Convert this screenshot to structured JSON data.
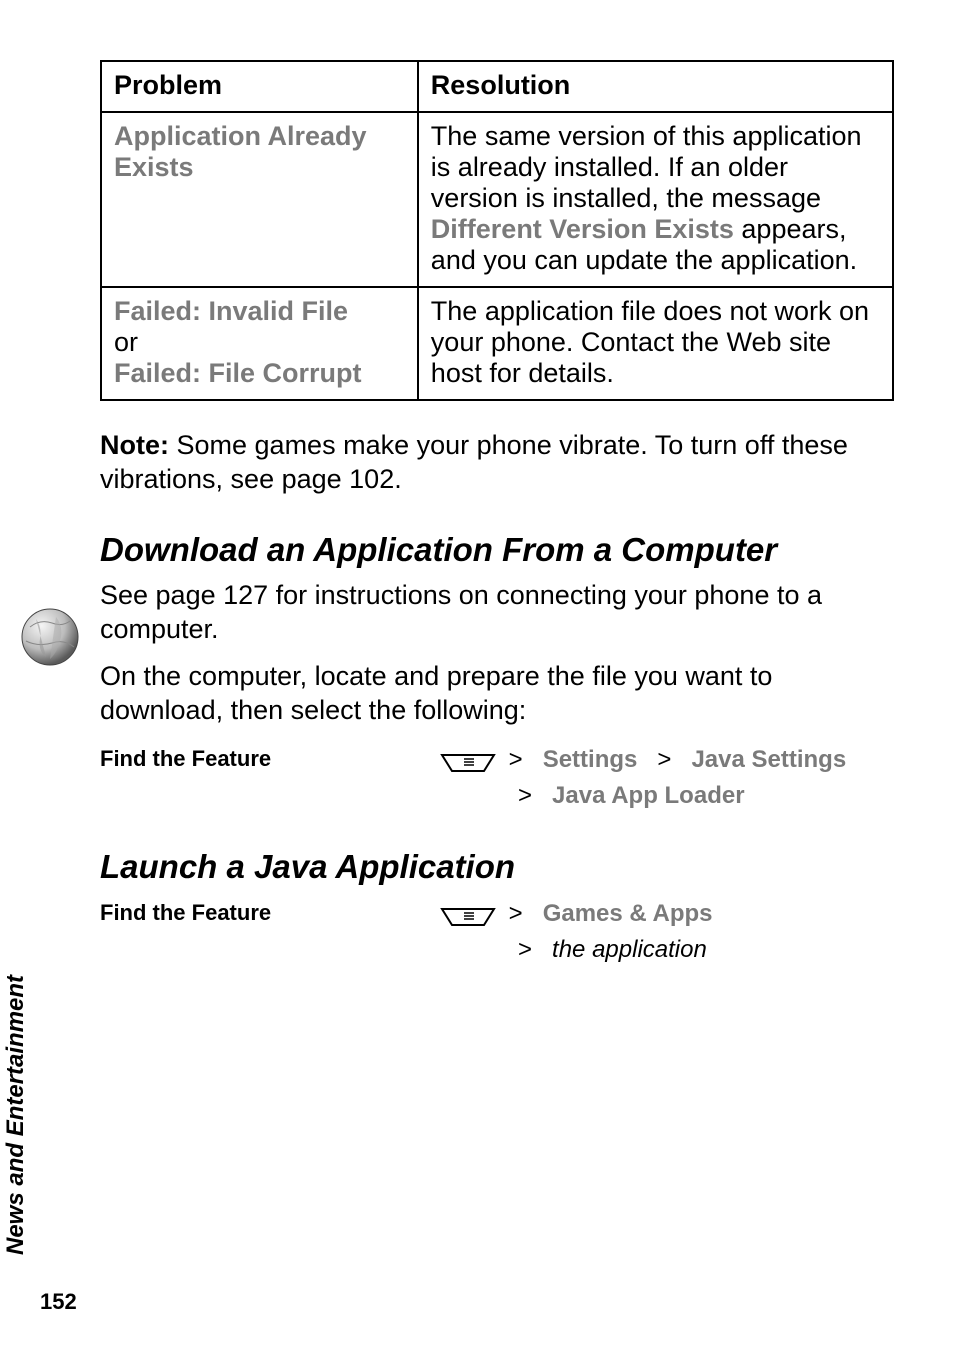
{
  "table": {
    "headers": {
      "problem": "Problem",
      "resolution": "Resolution"
    },
    "rows": [
      {
        "problem": "Application Already Exists",
        "resolution_pre": "The same version of this application is already installed. If an older version is installed, the message ",
        "resolution_highlight": "Different Version Exists",
        "resolution_post": " appears, and you can update the application."
      },
      {
        "problem_line1": "Failed: Invalid File",
        "problem_or": "or",
        "problem_line2": "Failed: File Corrupt",
        "resolution": "The application file does not work on your phone. Contact the Web site host for details."
      }
    ]
  },
  "note": {
    "label": "Note:",
    "text": " Some games make your phone vibrate. To turn off these vibrations, see page 102."
  },
  "section1": {
    "heading": "Download an Application From a Computer",
    "para1": "See page 127 for instructions on connecting your phone to a computer.",
    "para2": "On the computer, locate and prepare the file you want to download, then select the following:",
    "feature_label": "Find the Feature",
    "path": {
      "gt1": ">",
      "item1": "Settings",
      "gt2": ">",
      "item2": "Java Settings",
      "gt3": ">",
      "item3": "Java App Loader"
    }
  },
  "section2": {
    "heading": "Launch a Java Application",
    "feature_label": "Find the Feature",
    "path": {
      "gt1": ">",
      "item1": "Games & Apps",
      "gt2": ">",
      "item2": "the application"
    }
  },
  "rail": "News and Entertainment",
  "page_number": "152"
}
